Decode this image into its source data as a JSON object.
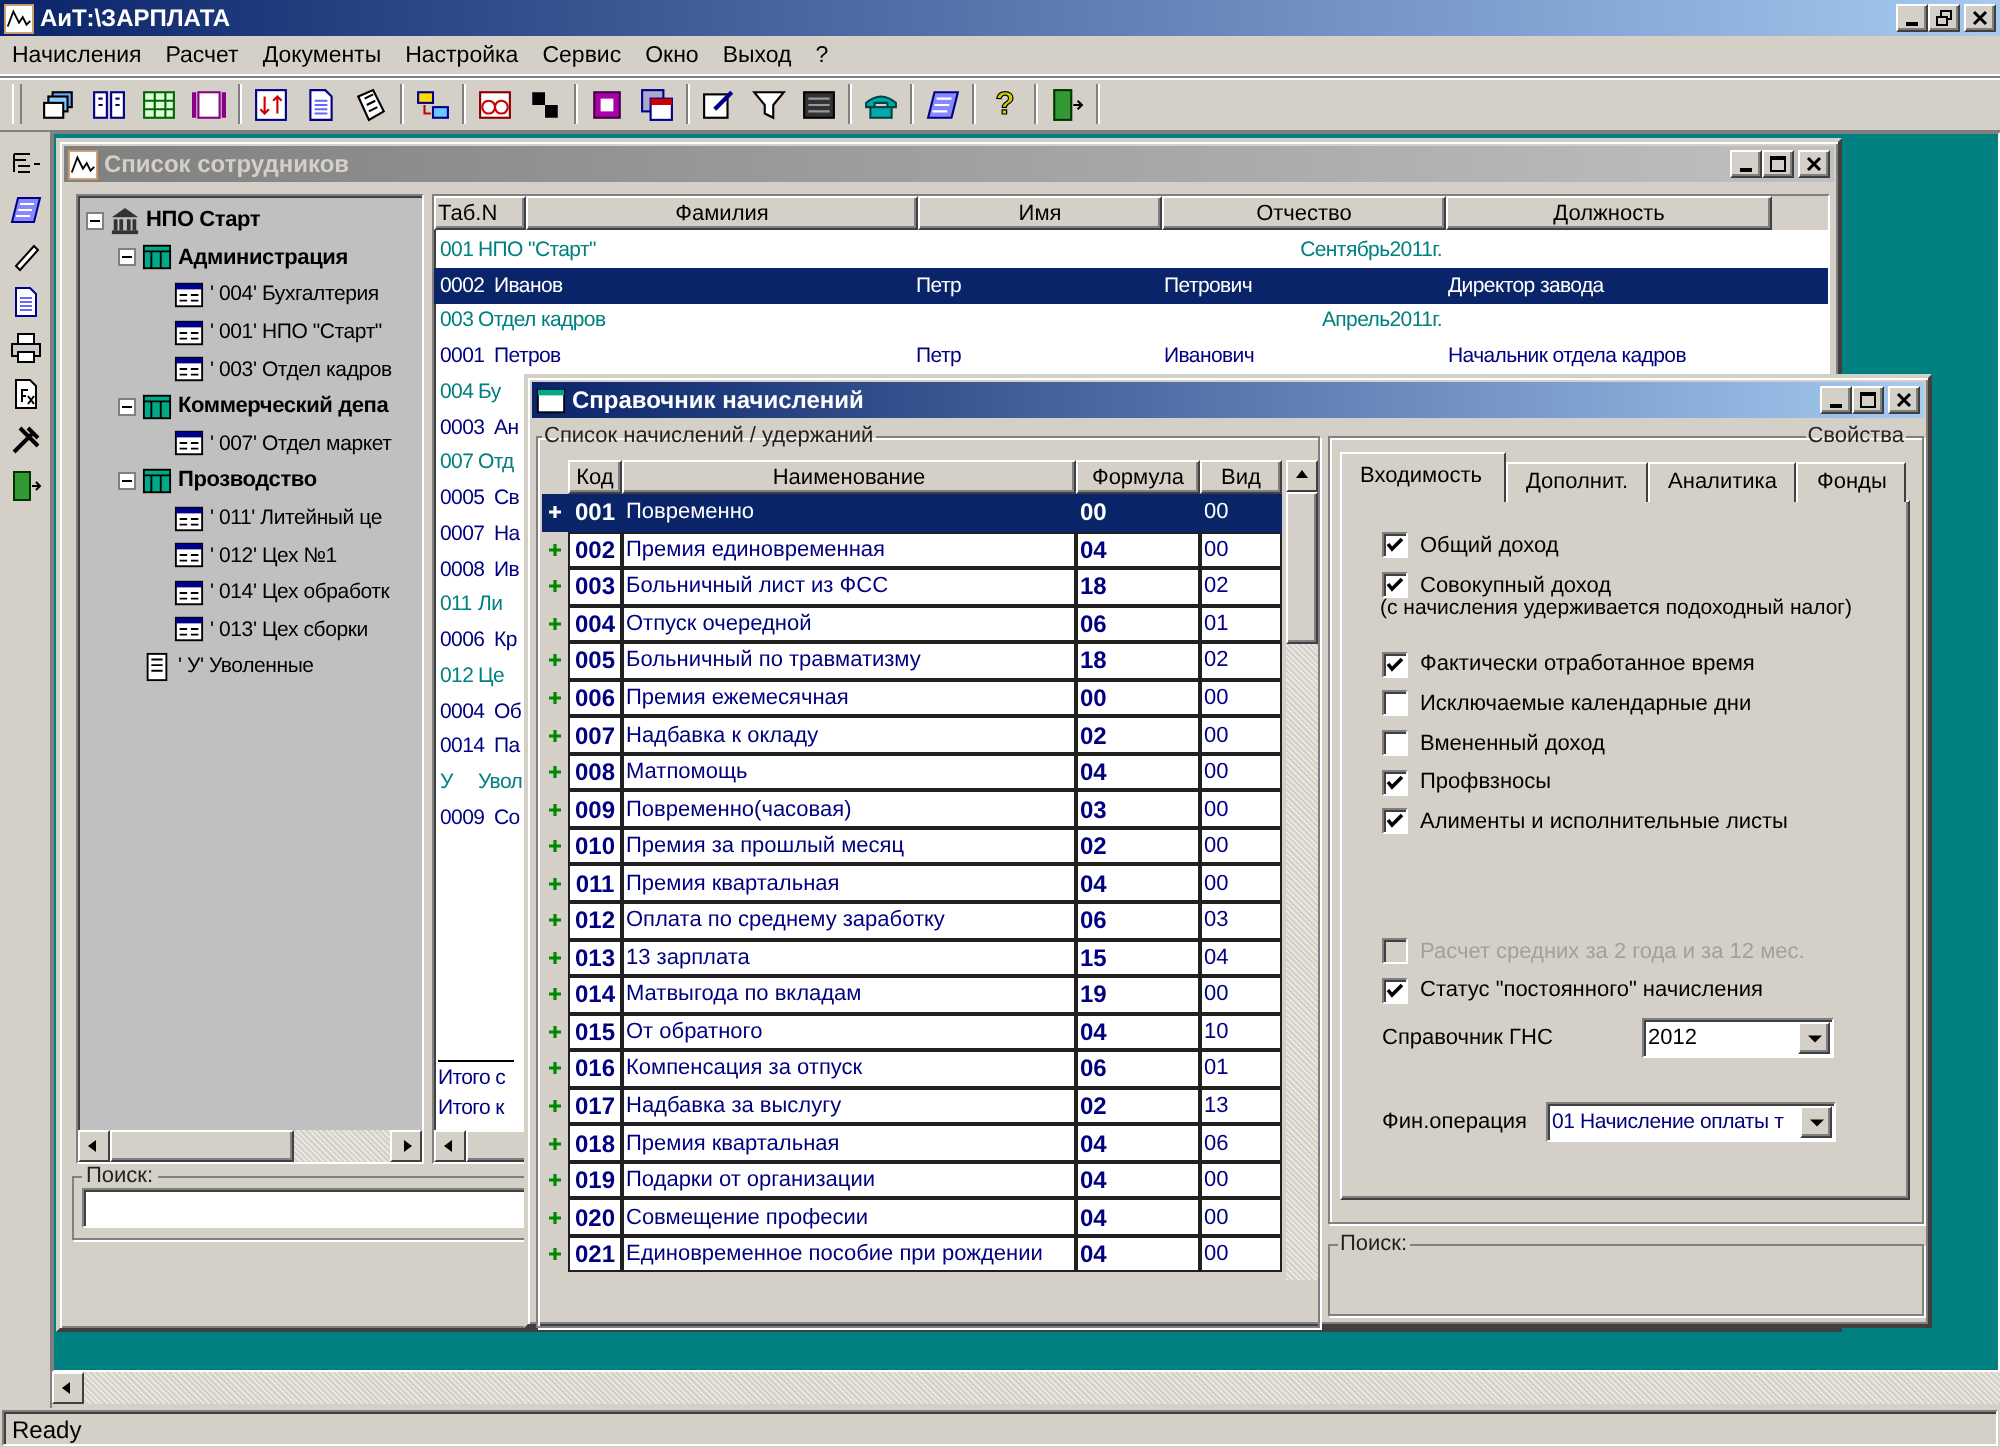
{
  "app": {
    "title": "АиТ:\\ЗАРПЛАТА",
    "menu": [
      "Начисления",
      "Расчет",
      "Документы",
      "Настройка",
      "Сервис",
      "Окно",
      "Выход",
      "?"
    ],
    "toolbar_help_glyph": "?",
    "status": "Ready"
  },
  "employees_window": {
    "title": "Список сотрудников",
    "tree": [
      {
        "label": "НПО Старт",
        "kind": "org",
        "expanded": true,
        "children": [
          {
            "label": "Администрация",
            "kind": "division",
            "expanded": true,
            "children": [
              {
                "label": "' 004' Бухгалтерия",
                "kind": "department"
              },
              {
                "label": "' 001' НПО \"Старт\"",
                "kind": "department"
              },
              {
                "label": "' 003' Отдел кадров",
                "kind": "department"
              }
            ]
          },
          {
            "label": "Коммерческий депа",
            "kind": "division",
            "expanded": true,
            "children": [
              {
                "label": "' 007' Отдел маркет",
                "kind": "department"
              }
            ]
          },
          {
            "label": "Прозводство",
            "kind": "division",
            "expanded": true,
            "children": [
              {
                "label": "' 011' Литейный це",
                "kind": "department"
              },
              {
                "label": "' 012' Цех №1",
                "kind": "department"
              },
              {
                "label": "' 014' Цех обработк",
                "kind": "department"
              },
              {
                "label": "' 013' Цех сборки",
                "kind": "department"
              }
            ]
          },
          {
            "label": "' У' Уволенные",
            "kind": "archive"
          }
        ]
      }
    ],
    "columns": [
      "Таб.N",
      "Фамилия",
      "Имя",
      "Отчество",
      "Должность"
    ],
    "rows": [
      {
        "kind": "group",
        "code": "001",
        "name": "НПО \"Старт\"",
        "period": "Сентябрь2011г.",
        "selected": false
      },
      {
        "kind": "person",
        "tab": "0002",
        "surname": "Иванов",
        "name": "Петр",
        "patronymic": "Петрович",
        "position": "Директор завода",
        "selected": true
      },
      {
        "kind": "group",
        "code": "003",
        "name": "Отдел кадров",
        "period": "Апрель2011г.",
        "selected": false
      },
      {
        "kind": "person",
        "tab": "0001",
        "surname": "Петров",
        "name": "Петр",
        "patronymic": "Иванович",
        "position": "Начальник отдела кадров",
        "selected": false
      },
      {
        "kind": "group",
        "code": "004",
        "name": "Бу",
        "selected": false
      },
      {
        "kind": "person",
        "tab": "0003",
        "surname": "Ан",
        "selected": false
      },
      {
        "kind": "group",
        "code": "007",
        "name": "Отд",
        "selected": false
      },
      {
        "kind": "person",
        "tab": "0005",
        "surname": "Св",
        "selected": false
      },
      {
        "kind": "person",
        "tab": "0007",
        "surname": "На",
        "selected": false
      },
      {
        "kind": "person",
        "tab": "0008",
        "surname": "Ив",
        "selected": false
      },
      {
        "kind": "group",
        "code": "011",
        "name": "Ли",
        "selected": false
      },
      {
        "kind": "person",
        "tab": "0006",
        "surname": "Кр",
        "selected": false
      },
      {
        "kind": "group",
        "code": "012",
        "name": "Це",
        "selected": false
      },
      {
        "kind": "person",
        "tab": "0004",
        "surname": "Об",
        "selected": false
      },
      {
        "kind": "person",
        "tab": "0014",
        "surname": "Па",
        "selected": false
      },
      {
        "kind": "group",
        "code": "У",
        "name": "Увол",
        "selected": false
      },
      {
        "kind": "person",
        "tab": "0009",
        "surname": "Со",
        "selected": false
      }
    ],
    "totals": [
      "Итого с",
      "Итого к"
    ],
    "search_label": "Поиск:"
  },
  "dialog": {
    "title": "Справочник начислений",
    "list_title": "Список начислений / удержаний",
    "columns": [
      "Код",
      "Наименование",
      "Формула",
      "Вид"
    ],
    "rows": [
      {
        "code": "001",
        "name": "Повременно",
        "formula": "00",
        "type": "00",
        "selected": true
      },
      {
        "code": "002",
        "name": "Премия единовременная",
        "formula": "04",
        "type": "00",
        "selected": false
      },
      {
        "code": "003",
        "name": "Больничный лист из ФСС",
        "formula": "18",
        "type": "02",
        "selected": false
      },
      {
        "code": "004",
        "name": "Отпуск очередной",
        "formula": "06",
        "type": "01",
        "selected": false
      },
      {
        "code": "005",
        "name": "Больничный по травматизму",
        "formula": "18",
        "type": "02",
        "selected": false
      },
      {
        "code": "006",
        "name": "Премия ежемесячная",
        "formula": "00",
        "type": "00",
        "selected": false
      },
      {
        "code": "007",
        "name": "Надбавка к окладу",
        "formula": "02",
        "type": "00",
        "selected": false
      },
      {
        "code": "008",
        "name": "Матпомощь",
        "formula": "04",
        "type": "00",
        "selected": false
      },
      {
        "code": "009",
        "name": "Повременно(часовая)",
        "formula": "03",
        "type": "00",
        "selected": false
      },
      {
        "code": "010",
        "name": "Премия за прошлый месяц",
        "formula": "02",
        "type": "00",
        "selected": false
      },
      {
        "code": "011",
        "name": "Премия квартальная",
        "formula": "04",
        "type": "00",
        "selected": false
      },
      {
        "code": "012",
        "name": "Оплата по среднему заработку",
        "formula": "06",
        "type": "03",
        "selected": false
      },
      {
        "code": "013",
        "name": "13 зарплата",
        "formula": "15",
        "type": "04",
        "selected": false
      },
      {
        "code": "014",
        "name": "Матвыгода по вкладам",
        "formula": "19",
        "type": "00",
        "selected": false
      },
      {
        "code": "015",
        "name": "От обратного",
        "formula": "04",
        "type": "10",
        "selected": false
      },
      {
        "code": "016",
        "name": "Компенсация за отпуск",
        "formula": "06",
        "type": "01",
        "selected": false
      },
      {
        "code": "017",
        "name": "Надбавка за выслугу",
        "formula": "02",
        "type": "13",
        "selected": false
      },
      {
        "code": "018",
        "name": "Премия квартальная",
        "formula": "04",
        "type": "06",
        "selected": false
      },
      {
        "code": "019",
        "name": "Подарки от организации",
        "formula": "04",
        "type": "00",
        "selected": false
      },
      {
        "code": "020",
        "name": "Совмещение професии",
        "formula": "04",
        "type": "00",
        "selected": false
      },
      {
        "code": "021",
        "name": "Единовременное пособие при рождении",
        "formula": "04",
        "type": "00",
        "selected": false
      }
    ],
    "properties": {
      "title": "Свойства",
      "tabs": [
        {
          "label": "Входимость",
          "selected": true
        },
        {
          "label": "Дополнит.",
          "selected": false
        },
        {
          "label": "Аналитика",
          "selected": false
        },
        {
          "label": "Фонды",
          "selected": false
        }
      ],
      "options": [
        {
          "kind": "checkbox",
          "label": "Общий доход",
          "checked": true,
          "disabled": false
        },
        {
          "kind": "checkbox",
          "label": "Совокупный доход",
          "checked": true,
          "disabled": false
        },
        {
          "kind": "note",
          "label": "(с начисления удерживается подоходный налог)"
        },
        {
          "kind": "checkbox",
          "label": "Фактически отработанное время",
          "checked": true,
          "disabled": false
        },
        {
          "kind": "checkbox",
          "label": "Исключаемые календарные дни",
          "checked": false,
          "disabled": false
        },
        {
          "kind": "checkbox",
          "label": "Вмененный доход",
          "checked": false,
          "disabled": false
        },
        {
          "kind": "checkbox",
          "label": "Профвзносы",
          "checked": true,
          "disabled": false
        },
        {
          "kind": "checkbox",
          "label": "Алименты и исполнительные листы",
          "checked": true,
          "disabled": false
        }
      ],
      "options2": [
        {
          "kind": "checkbox",
          "label": "Расчет средних за 2 года и за 12 мес.",
          "checked": false,
          "disabled": true
        },
        {
          "kind": "checkbox",
          "label": "Статус \"постоянного\" начисления",
          "checked": true,
          "disabled": false
        }
      ],
      "gns": {
        "label": "Справочник ГНС",
        "value": "2012"
      },
      "fin": {
        "label": "Фин.операция",
        "value": "01  Начисление оплаты т"
      }
    },
    "search_label": "Поиск:"
  }
}
